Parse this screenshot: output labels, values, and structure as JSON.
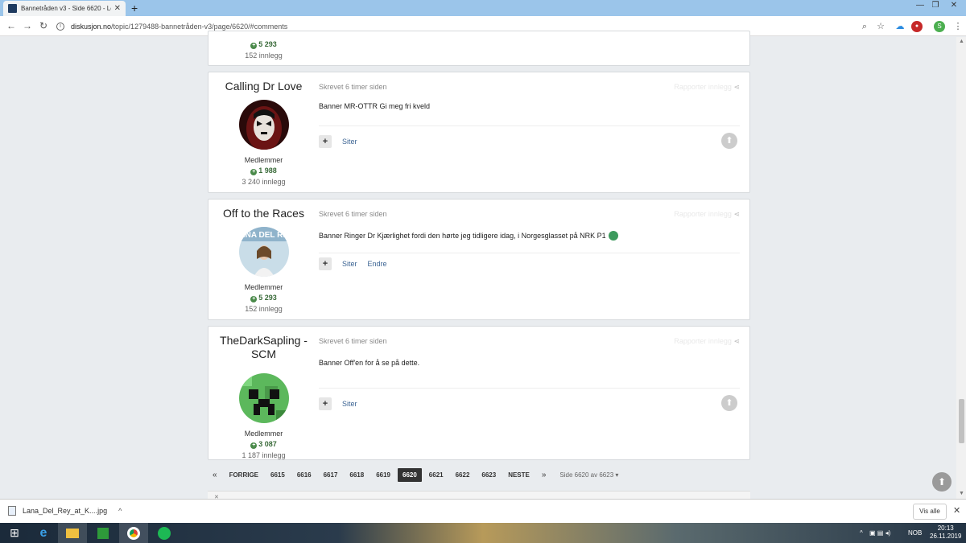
{
  "browser": {
    "tab_title": "Bannetråden v3 - Side 6620 - Le",
    "tab_close": "✕",
    "new_tab": "+",
    "url_host": "diskusjon.no",
    "url_path": "/topic/1279488-bannetråden-v3/page/6620/#comments",
    "window_controls": [
      "—",
      "❐",
      "✕"
    ]
  },
  "posts": [
    {
      "author": "",
      "role": "",
      "reputation": "5 293",
      "post_count": "152 innlegg"
    },
    {
      "author": "Calling Dr Love",
      "role": "Medlemmer",
      "reputation": "1 988",
      "post_count": "3 240 innlegg",
      "meta": "Skrevet 6 timer siden",
      "report": "Rapporter innlegg",
      "text": "Banner MR-OTTR Gi meg fri kveld",
      "actions": [
        "Siter"
      ]
    },
    {
      "author": "Off to the Races",
      "role": "Medlemmer",
      "reputation": "5 293",
      "post_count": "152 innlegg",
      "meta": "Skrevet 6 timer siden",
      "report": "Rapporter innlegg",
      "text": "Banner Ringer Dr Kjærlighet fordi den hørte jeg tidligere idag, i Norgesglasset på NRK P1",
      "actions": [
        "Siter",
        "Endre"
      ]
    },
    {
      "author": "TheDarkSapling - SCM",
      "role": "Medlemmer",
      "reputation": "3 087",
      "post_count": "1 187 innlegg",
      "meta": "Skrevet 6 timer siden",
      "report": "Rapporter innlegg",
      "text": "Banner Off'en for å se på dette.",
      "actions": [
        "Siter"
      ]
    }
  ],
  "pagination": {
    "first": "«",
    "prev": "FORRIGE",
    "pages": [
      "6615",
      "6616",
      "6617",
      "6618",
      "6619",
      "6620",
      "6621",
      "6622",
      "6623"
    ],
    "current": "6620",
    "next": "NESTE",
    "last": "»",
    "info": "Side 6620 av 6623 ▾"
  },
  "downloads": {
    "file": "Lana_Del_Rey_at_K....jpg",
    "show_all": "Vis alle"
  },
  "taskbar": {
    "lang": "NOB",
    "time": "20:13",
    "date": "26.11.2019"
  },
  "colors": {
    "link": "#3d6594",
    "reputation": "#3a6b3a",
    "active_page": "#333333"
  }
}
